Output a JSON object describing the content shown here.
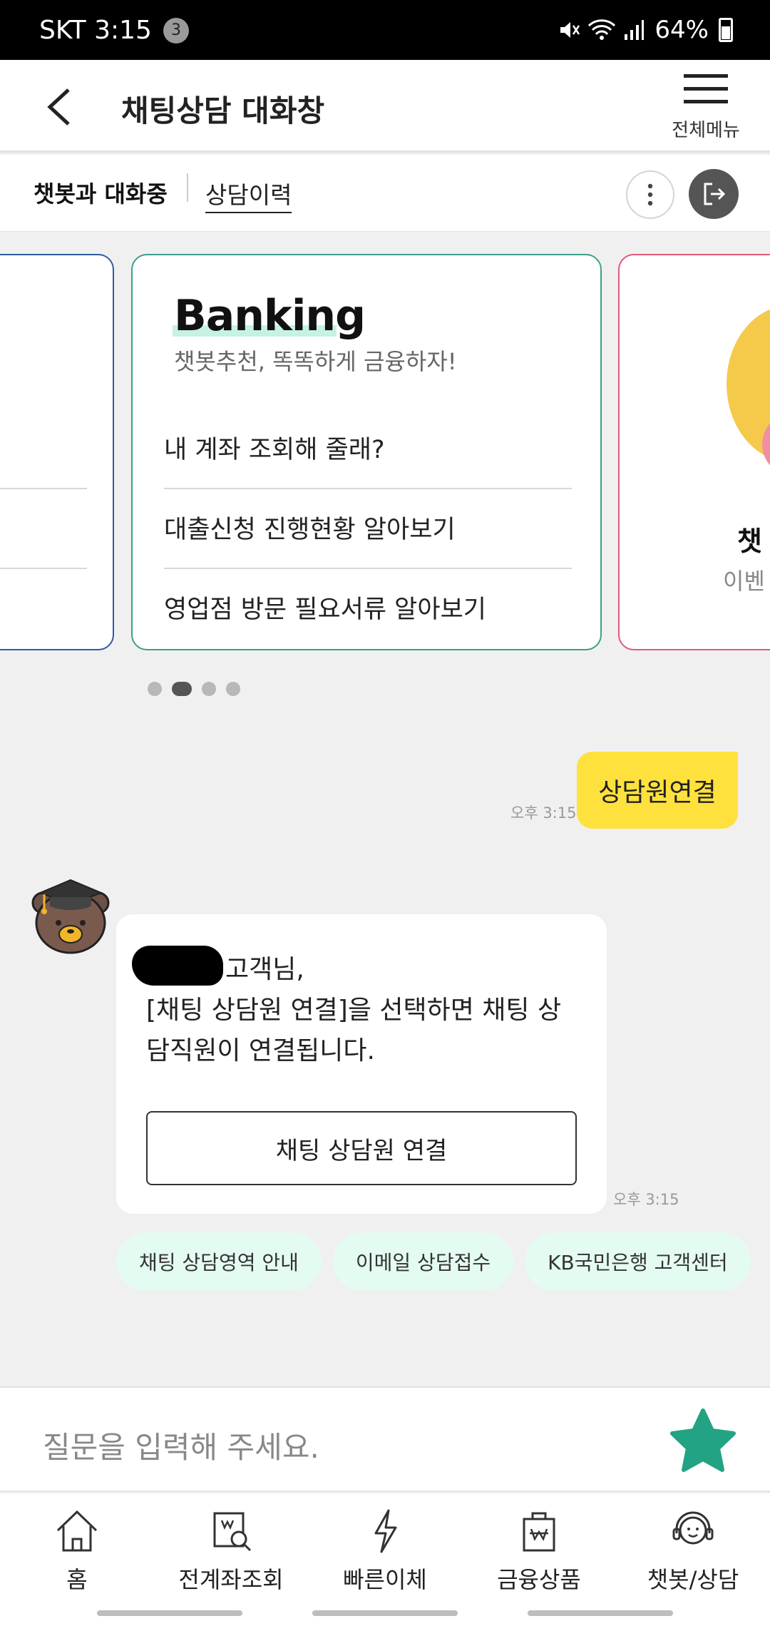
{
  "status_bar": {
    "carrier_time": "SKT 3:15",
    "notification_count": "3",
    "battery": "64%"
  },
  "header": {
    "title": "채팅상담 대화창",
    "menu_label": "전체메뉴"
  },
  "subbar": {
    "active_tab": "챗봇과 대화중",
    "history_link": "상담이력"
  },
  "carousel": {
    "main_card": {
      "title": "Banking",
      "subtitle": "챗봇추천, 똑똑하게 금융하자!",
      "items": [
        "내 계좌 조회해 줄래?",
        "대출신청 진행현황 알아보기",
        "영업점 방문 필요서류 알아보기"
      ]
    },
    "right_card": {
      "title_partial": "챗",
      "subtitle_partial": "이벤"
    },
    "page_count": 4,
    "active_page": 2
  },
  "conversation": {
    "user_message": "상담원연결",
    "user_time": "오후 3:15",
    "bot_greeting": "고객님,",
    "bot_message": "[채팅 상담원 연결]을 선택하면 채팅 상담직원이 연결됩니다.",
    "bot_button": "채팅 상담원 연결",
    "bot_time": "오후 3:15",
    "quick_replies": [
      "채팅 상담영역 안내",
      "이메일 상담접수",
      "KB국민은행 고객센터"
    ]
  },
  "input": {
    "placeholder": "질문을 입력해 주세요."
  },
  "bottom_nav": [
    {
      "label": "홈",
      "icon": "home-icon"
    },
    {
      "label": "전계좌조회",
      "icon": "account-search-icon"
    },
    {
      "label": "빠른이체",
      "icon": "lightning-icon"
    },
    {
      "label": "금융상품",
      "icon": "financial-product-icon"
    },
    {
      "label": "챗봇/상담",
      "icon": "chatbot-agent-icon"
    }
  ],
  "colors": {
    "accent_green": "#22a383",
    "user_bubble": "#ffe13d",
    "chip_bg": "#e4fbf1"
  }
}
